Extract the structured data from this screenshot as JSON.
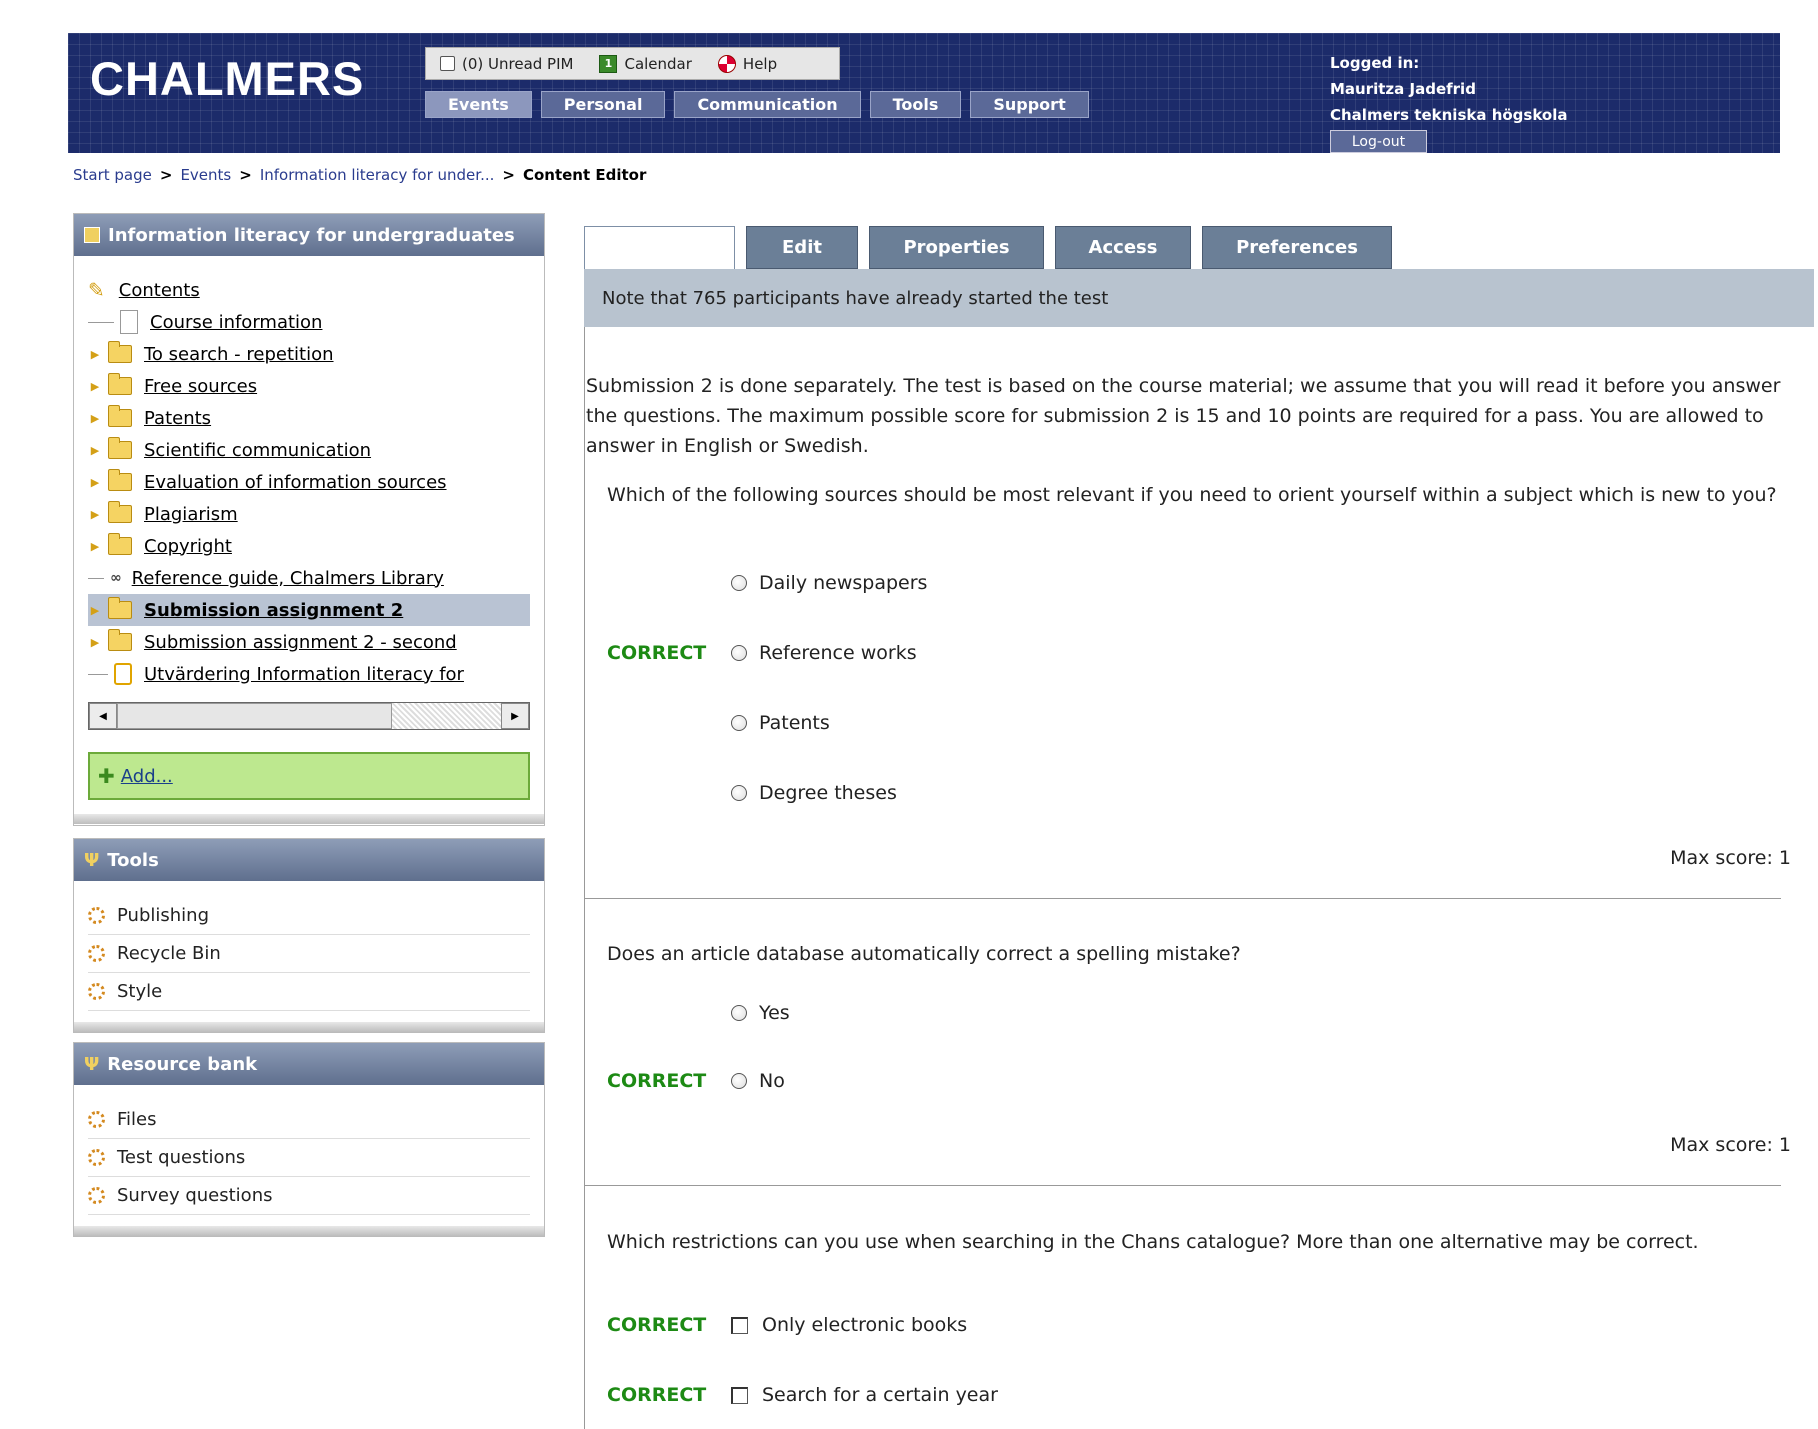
{
  "header": {
    "logo": "CHALMERS",
    "util": {
      "pim": "(0) Unread PIM",
      "calendar": "Calendar",
      "help": "Help"
    },
    "nav": [
      "Events",
      "Personal",
      "Communication",
      "Tools",
      "Support"
    ],
    "login": {
      "label": "Logged in:",
      "name": "Mauritza Jadefrid",
      "org": "Chalmers tekniska högskola",
      "logout": "Log-out"
    }
  },
  "breadcrumb": {
    "items": [
      "Start page",
      "Events",
      "Information literacy for under..."
    ],
    "sep": ">",
    "current": "Content Editor"
  },
  "sidebar": {
    "course_title": "Information literacy for undergraduates",
    "tree": [
      {
        "label": "Contents",
        "type": "root"
      },
      {
        "label": "Course information",
        "type": "page"
      },
      {
        "label": "To search - repetition",
        "type": "folder"
      },
      {
        "label": "Free sources",
        "type": "folder"
      },
      {
        "label": "Patents",
        "type": "folder"
      },
      {
        "label": "Scientific communication",
        "type": "folder"
      },
      {
        "label": "Evaluation of information sources",
        "type": "folder"
      },
      {
        "label": "Plagiarism",
        "type": "folder"
      },
      {
        "label": "Copyright",
        "type": "folder"
      },
      {
        "label": "Reference guide, Chalmers Library",
        "type": "link"
      },
      {
        "label": "Submission assignment 2",
        "type": "folder",
        "selected": true
      },
      {
        "label": "Submission assignment 2 - second",
        "type": "folder-edit"
      },
      {
        "label": "Utvärdering Information literacy for",
        "type": "form"
      }
    ],
    "add_label": "Add...",
    "tools_title": "Tools",
    "tools": [
      "Publishing",
      "Recycle Bin",
      "Style"
    ],
    "resource_title": "Resource bank",
    "resources": [
      "Files",
      "Test questions",
      "Survey questions"
    ]
  },
  "tabs": [
    "",
    "Edit",
    "Properties",
    "Access",
    "Preferences"
  ],
  "note": "Note that 765 participants have already started the test",
  "intro": "Submission 2 is done separately. The test is based on the course material; we assume that you will read it before you answer the questions. The maximum possible score for submission 2 is 15 and 10 points are required for a pass. You are allowed to answer in English or Swedish.",
  "correct_label": "CORRECT",
  "questions": [
    {
      "text": "Which of the following sources should be most relevant if you need to orient yourself within a subject which is new to you?",
      "options": [
        "Daily newspapers",
        "Reference works",
        "Patents",
        "Degree theses"
      ],
      "correct": [
        1
      ],
      "max_score": "Max score: 1"
    },
    {
      "text": "Does an article database automatically correct a spelling mistake?",
      "options": [
        "Yes",
        "No"
      ],
      "correct": [
        1
      ],
      "max_score": "Max score: 1"
    },
    {
      "text": "Which restrictions can you use when searching in the Chans catalogue? More than one alternative may be correct.",
      "options": [
        "Only electronic books",
        "Search for a certain year"
      ],
      "correct": [
        0,
        1
      ]
    }
  ]
}
